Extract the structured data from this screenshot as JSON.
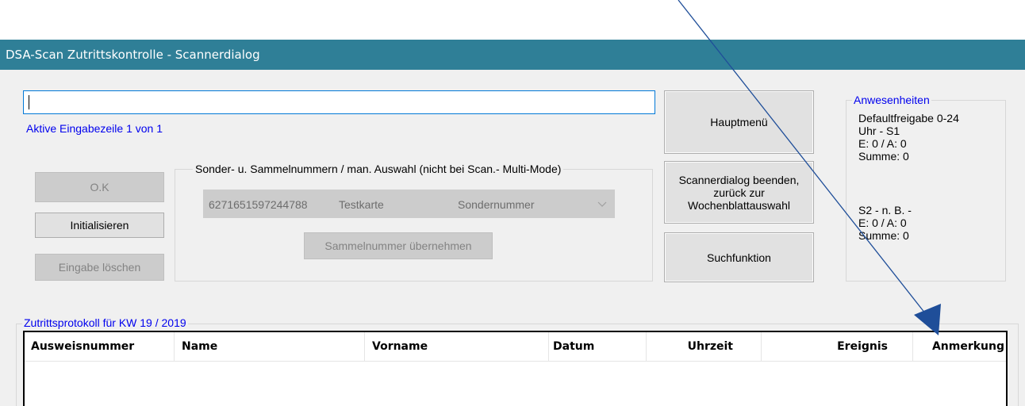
{
  "window": {
    "title": "DSA-Scan Zutrittskontrolle - Scannerdialog"
  },
  "input": {
    "value": "",
    "status": "Aktive Eingabezeile 1 von 1"
  },
  "buttons": {
    "ok": "O.K",
    "initialisieren": "Initialisieren",
    "eingabe_loeschen": "Eingabe löschen",
    "hauptmenue": "Hauptmenü",
    "scannerdialog_beenden": "Scannerdialog beenden, zurück zur Wochenblattauswahl",
    "suchfunktion": "Suchfunktion",
    "sammelnummer": "Sammelnummer übernehmen"
  },
  "sonder_group": {
    "legend": "Sonder- u.  Sammelnummern / man.  Auswahl (nicht bei Scan.- Multi-Mode)",
    "combo": {
      "number": "6271651597244788",
      "name": "Testkarte",
      "type": "Sondernummer"
    }
  },
  "anwesenheiten": {
    "legend": "Anwesenheiten",
    "s1": {
      "line1": "Defaultfreigabe 0-24",
      "line2": "Uhr - S1",
      "line3": "E: 0 / A: 0",
      "line4": "Summe: 0"
    },
    "s2": {
      "line1": "S2 - n. B. -",
      "line2": "E: 0 / A: 0",
      "line3": "Summe: 0"
    }
  },
  "protokoll": {
    "legend": "Zutrittsprotokoll für KW 19 / 2019",
    "columns": [
      "Ausweisnummer",
      "Name",
      "Vorname",
      "Datum",
      "Uhrzeit",
      "Ereignis",
      "Anmerkung"
    ]
  },
  "colors": {
    "titlebar": "#2f7f97",
    "blue_text": "#0000ee",
    "annotation": "#1f4e99"
  }
}
